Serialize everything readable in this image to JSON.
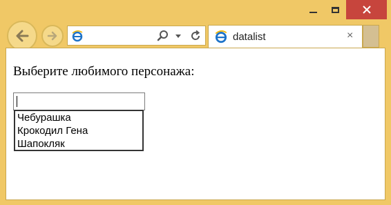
{
  "browser": {
    "tab": {
      "title": "datalist",
      "close_glyph": "×"
    },
    "icons": {
      "back": "back-arrow-icon",
      "forward": "forward-arrow-icon",
      "page": "internet-explorer-icon",
      "search": "search-icon",
      "dropdown": "chevron-down-icon",
      "refresh": "refresh-icon",
      "minimize": "minimize-icon",
      "maximize": "maximize-icon",
      "close": "close-icon"
    },
    "colors": {
      "frame": "#f0c866",
      "close_button": "#c7453d"
    }
  },
  "page": {
    "prompt": "Выберите любимого персонажа:",
    "input": {
      "value": ""
    },
    "suggestions": [
      "Чебурашка",
      "Крокодил Гена",
      "Шапокляк"
    ]
  }
}
